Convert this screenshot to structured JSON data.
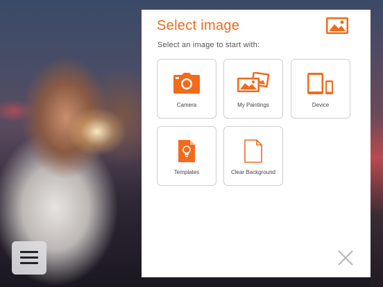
{
  "colors": {
    "accent": "#f26a1b",
    "panel_bg": "#ffffff",
    "tile_border": "#cfcfcf",
    "close_icon": "#b8b8b8",
    "menu_button_bg": "#dcdce0"
  },
  "dialog": {
    "title": "Select image",
    "subtitle": "Select an image to start with:",
    "header_icon": "image-icon",
    "close_icon": "close-icon"
  },
  "options": [
    {
      "label": "Camera",
      "icon": "camera-icon"
    },
    {
      "label": "My Paintings",
      "icon": "paintings-icon"
    },
    {
      "label": "Device",
      "icon": "device-icon"
    },
    {
      "label": "Templates",
      "icon": "template-icon"
    },
    {
      "label": "Clear Background",
      "icon": "blank-page-icon"
    }
  ],
  "menu_button": {
    "icon": "hamburger-menu-icon"
  }
}
